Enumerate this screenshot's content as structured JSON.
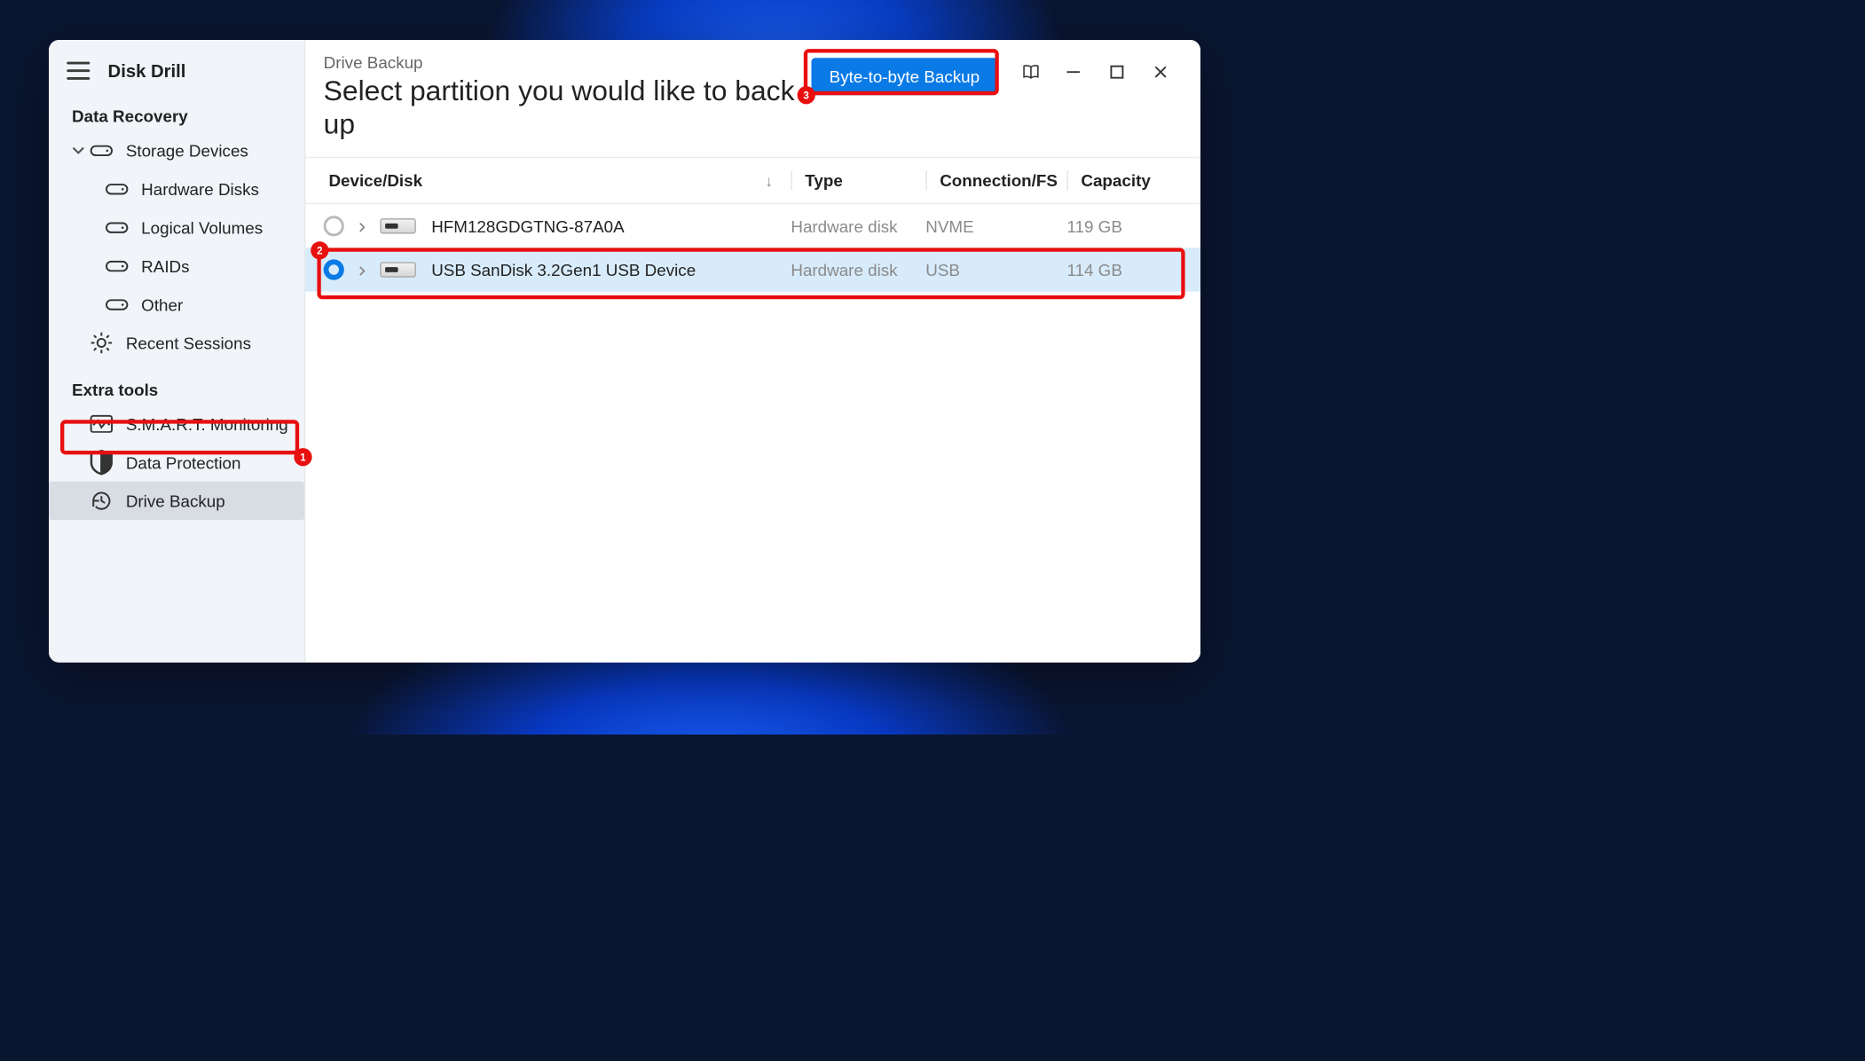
{
  "app_name": "Disk Drill",
  "sidebar": {
    "section1_title": "Data Recovery",
    "storage_devices": "Storage Devices",
    "hardware_disks": "Hardware Disks",
    "logical_volumes": "Logical Volumes",
    "raids": "RAIDs",
    "other": "Other",
    "recent_sessions": "Recent Sessions",
    "section2_title": "Extra tools",
    "smart": "S.M.A.R.T. Monitoring",
    "data_protection": "Data Protection",
    "drive_backup": "Drive Backup"
  },
  "header": {
    "crumb": "Drive Backup",
    "title": "Select partition you would like to back up",
    "primary_button": "Byte-to-byte Backup"
  },
  "columns": {
    "device": "Device/Disk",
    "type": "Type",
    "conn": "Connection/FS",
    "capacity": "Capacity"
  },
  "rows": [
    {
      "name": "HFM128GDGTNG-87A0A",
      "type": "Hardware disk",
      "conn": "NVME",
      "capacity": "119 GB",
      "selected": false
    },
    {
      "name": "USB  SanDisk 3.2Gen1 USB Device",
      "type": "Hardware disk",
      "conn": "USB",
      "capacity": "114 GB",
      "selected": true
    }
  ],
  "callouts": {
    "one": "1",
    "two": "2",
    "three": "3"
  }
}
